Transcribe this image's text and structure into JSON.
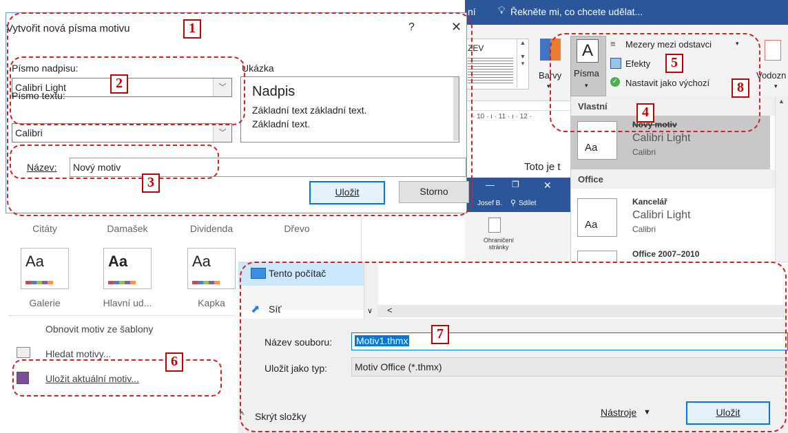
{
  "word_ribbon": {
    "tell_me": "Řekněte mi, co chcete udělat...",
    "tab_fragment": "ní",
    "style_fragment": "ZEV",
    "colors_label": "Barvy",
    "fonts_label": "Písma",
    "fonts_glyph": "A",
    "paragraph_spacing": "Mezery mezi odstavci",
    "effects": "Efekty",
    "set_default": "Nastavit jako výchozí",
    "watermark_fragment": "Vodozn",
    "ruler_text": "· 10 · ı · 11 · ı · 12 ·",
    "doc_text": "Toto je t"
  },
  "fonts_dropdown": {
    "section_custom": "Vlastní",
    "section_office": "Office",
    "items": [
      {
        "name": "Nový motiv",
        "heading": "Calibri Light",
        "body": "Calibri",
        "sample": "Aa"
      },
      {
        "name": "Kancelář",
        "heading": "Calibri Light",
        "body": "Calibri",
        "sample": "Aa"
      },
      {
        "name": "Office 2007–2010",
        "heading": "",
        "body": "",
        "sample": ""
      }
    ]
  },
  "dialog": {
    "title": "Vytvořit nová písma motivu",
    "help": "?",
    "close": "✕",
    "heading_font_label": "Písmo nadpisu:",
    "heading_font_value": "Calibri Light",
    "body_font_label": "Písmo textu:",
    "body_font_value": "Calibri",
    "preview_label": "Ukázka",
    "preview_heading": "Nadpis",
    "preview_body1": "Základní text základní text.",
    "preview_body2": "Základní text.",
    "name_label": "Název:",
    "name_value": "Nový motiv",
    "save": "Uložit",
    "cancel": "Storno"
  },
  "small_window": {
    "user": "Josef B.",
    "share": "Sdílet",
    "page_borders": "Ohraničení stránky"
  },
  "themes_panel": {
    "row1": [
      "Citáty",
      "Damašek",
      "Dividenda",
      "Dřevo"
    ],
    "row2": [
      "Galerie",
      "Hlavní ud...",
      "Kapka"
    ],
    "reset": "Obnovit motiv ze šablony",
    "browse": "Hledat motivy...",
    "save_current": "Uložit aktuální motiv..."
  },
  "save_dialog": {
    "this_pc": "Tento počítač",
    "network": "Síť",
    "filename_label": "Název souboru:",
    "filename_value": "Motiv1.thmx",
    "type_label": "Uložit jako typ:",
    "type_value": "Motiv Office (*.thmx)",
    "hide_folders": "Skrýt složky",
    "tools": "Nástroje",
    "save": "Uložit"
  },
  "markers": [
    "1",
    "2",
    "3",
    "4",
    "5",
    "6",
    "7",
    "8"
  ],
  "colors": {
    "accent": "#0078d7",
    "annotation": "#c00000",
    "selected": "#c8c8c8"
  }
}
